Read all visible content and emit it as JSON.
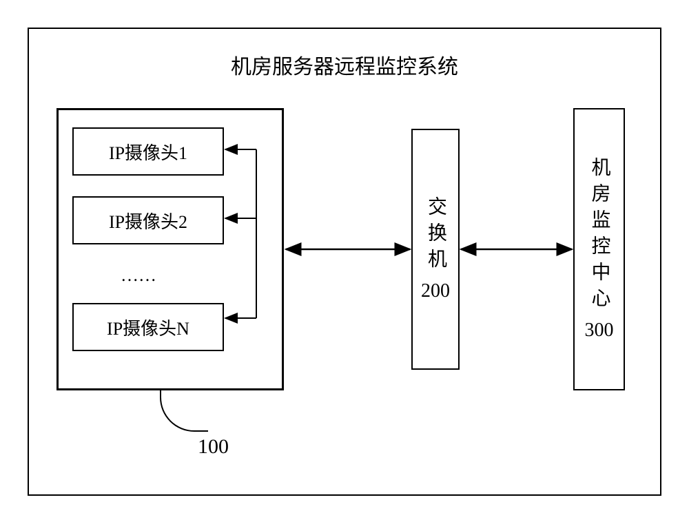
{
  "title": "机房服务器远程监控系统",
  "serverGroup": {
    "cameras": {
      "c1": "IP摄像头1",
      "c2": "IP摄像头2",
      "cn": "IP摄像头N"
    },
    "ellipsis": "……",
    "labelNum": "100"
  },
  "switch": {
    "name": "交换机",
    "num": "200"
  },
  "monitorCenter": {
    "name": "机房监控中心",
    "num": "300"
  }
}
